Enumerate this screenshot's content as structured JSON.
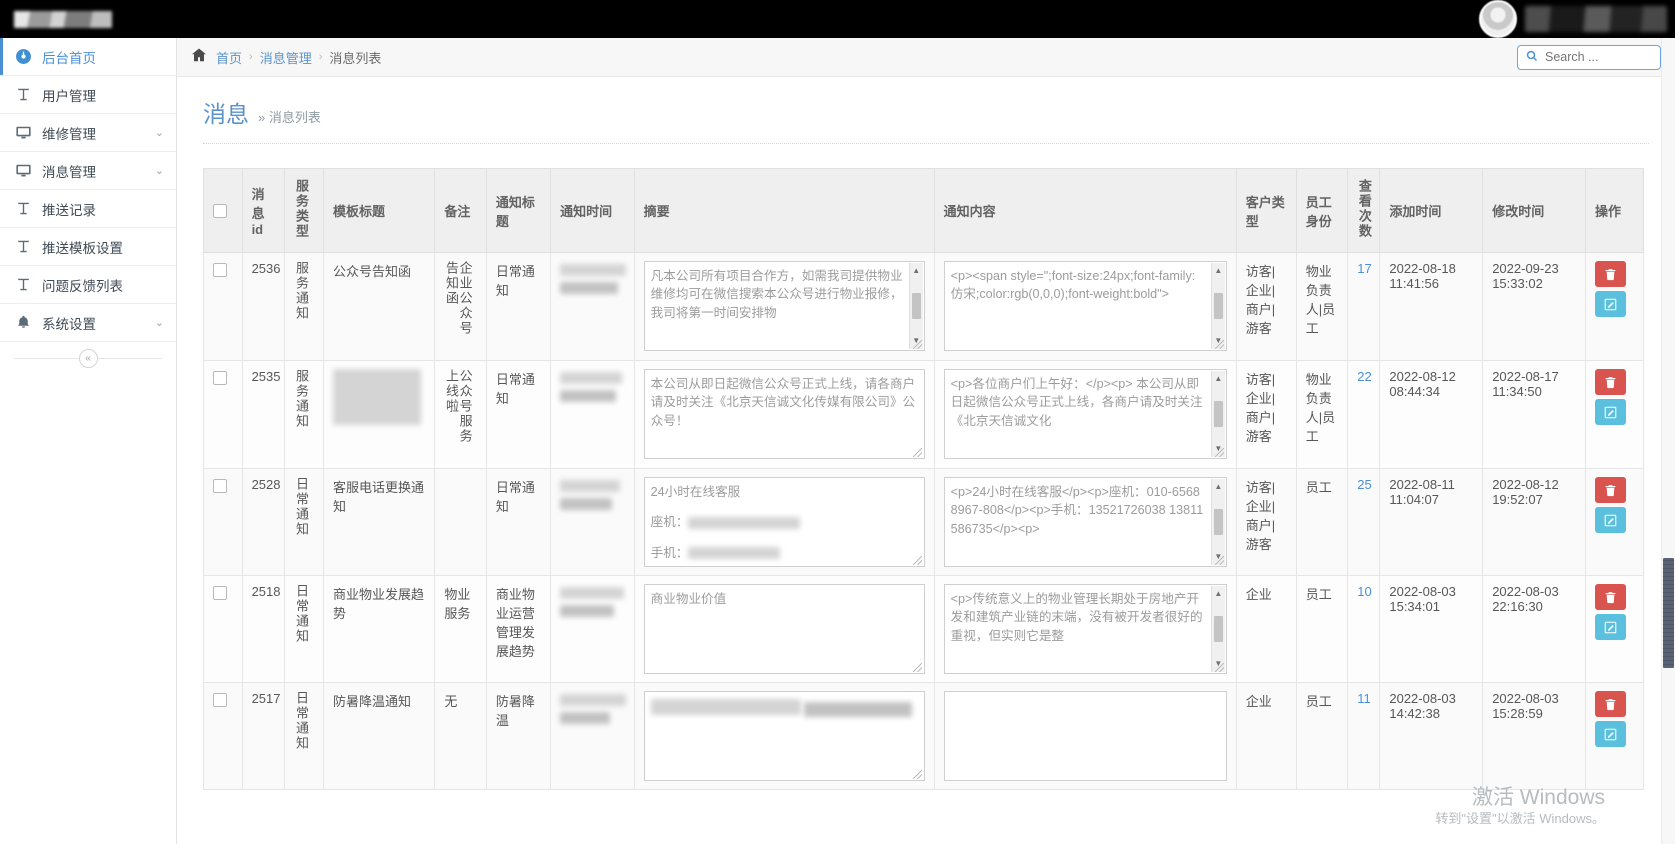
{
  "topbar": {
    "brand_label": "",
    "user_label": "",
    "avatar_name": "user-avatar"
  },
  "sidebar": {
    "items": [
      {
        "label": "后台首页",
        "icon": "dashboard-icon",
        "active": true,
        "expandable": false
      },
      {
        "label": "用户管理",
        "icon": "text-icon",
        "active": false,
        "expandable": false
      },
      {
        "label": "维修管理",
        "icon": "monitor-icon",
        "active": false,
        "expandable": true
      },
      {
        "label": "消息管理",
        "icon": "monitor-icon",
        "active": false,
        "expandable": true
      },
      {
        "label": "推送记录",
        "icon": "text-icon",
        "active": false,
        "expandable": false
      },
      {
        "label": "推送模板设置",
        "icon": "text-icon",
        "active": false,
        "expandable": false
      },
      {
        "label": "问题反馈列表",
        "icon": "text-icon",
        "active": false,
        "expandable": false
      },
      {
        "label": "系统设置",
        "icon": "bell-icon",
        "active": false,
        "expandable": true
      }
    ],
    "collapse_label": "«"
  },
  "breadcrumb": {
    "home_icon": "home-icon",
    "items": [
      "首页",
      "消息管理",
      "消息列表"
    ],
    "separator": "›"
  },
  "search": {
    "placeholder": "Search ...",
    "value": "",
    "icon": "search-icon"
  },
  "page": {
    "title": "消息",
    "subtitle": "» 消息列表"
  },
  "table": {
    "columns": [
      {
        "key": "check",
        "label": "",
        "vertical": false
      },
      {
        "key": "id",
        "label": "消息id",
        "vertical": false
      },
      {
        "key": "svc",
        "label": "服务类型",
        "vertical": true
      },
      {
        "key": "tpl",
        "label": "模板标题",
        "vertical": false
      },
      {
        "key": "note",
        "label": "备注",
        "vertical": false
      },
      {
        "key": "ntitle",
        "label": "通知标题",
        "vertical": false
      },
      {
        "key": "ntime",
        "label": "通知时间",
        "vertical": false
      },
      {
        "key": "abs",
        "label": "摘要",
        "vertical": false
      },
      {
        "key": "content",
        "label": "通知内容",
        "vertical": false
      },
      {
        "key": "ctype",
        "label": "客户类型",
        "vertical": false
      },
      {
        "key": "emp",
        "label": "员工身份",
        "vertical": false
      },
      {
        "key": "views",
        "label": "查看次数",
        "vertical": true
      },
      {
        "key": "added",
        "label": "添加时间",
        "vertical": false
      },
      {
        "key": "modified",
        "label": "修改时间",
        "vertical": false
      },
      {
        "key": "op",
        "label": "操作",
        "vertical": false
      }
    ],
    "rows": [
      {
        "id": "2536",
        "svc": "服务通知",
        "tpl": "公众号告知函",
        "tpl_redacted": false,
        "note": "企业公众号告知函",
        "ntitle": "日常通知",
        "ntime_redacted": true,
        "abs": "凡本公司所有项目合作方，如需我司提供物业维修均可在微信搜索本公众号进行物业报修，我司将第一时间安排物",
        "abs_scroll": true,
        "content": "<p><span style=\";font-size:24px;font-family:仿宋;color:rgb(0,0,0);font-weight:bold\">",
        "content_scroll": true,
        "ctype": "访客|企业|商户|游客",
        "emp": "物业负责人|员工",
        "views": "17",
        "added": "2022-08-18 11:41:56",
        "modified": "2022-09-23 15:33:02"
      },
      {
        "id": "2535",
        "svc": "服务通知",
        "tpl": "",
        "tpl_redacted": true,
        "note": "公众号服务上线啦",
        "ntitle": "日常通知",
        "ntime_redacted": true,
        "abs": "本公司从即日起微信公众号正式上线，请各商户请及时关注《北京天信诚文化传媒有限公司》公众号！",
        "abs_scroll": false,
        "content": "<p>各位商户们上午好：</p><p>  本公司从即日起微信公众号正式上线，各商户请及时关注《北京天信诚文化",
        "content_scroll": true,
        "ctype": "访客|企业|商户|游客",
        "emp": "物业负责人|员工",
        "views": "22",
        "added": "2022-08-12 08:44:34",
        "modified": "2022-08-17 11:34:50"
      },
      {
        "id": "2528",
        "svc": "日常通知",
        "tpl": "客服电话更换通知",
        "tpl_redacted": false,
        "note": "",
        "ntitle": "日常通知",
        "ntime_redacted": true,
        "abs": "24小时在线客服",
        "abs_line2_label": "座机：",
        "abs_line3_label": "手机：",
        "abs_redacted_lines": true,
        "abs_scroll": false,
        "content": "<p>24小时在线客服</p><p>座机：010-65688967-808</p><p>手机：13521726038 13811586735</p><p>",
        "content_scroll": true,
        "ctype": "访客|企业|商户|游客",
        "emp": "员工",
        "views": "25",
        "added": "2022-08-11 11:04:07",
        "modified": "2022-08-12 19:52:07"
      },
      {
        "id": "2518",
        "svc": "日常通知",
        "tpl": "商业物业发展趋势",
        "tpl_redacted": false,
        "note": "物业服务",
        "ntitle": "商业物业运营管理发展趋势",
        "ntime_redacted": true,
        "abs": "商业物业价值",
        "abs_scroll": false,
        "content": "<p>传统意义上的物业管理长期处于房地产开发和建筑产业链的末端，没有被开发者很好的重视，但实则它是整",
        "content_scroll": true,
        "ctype": "企业",
        "emp": "员工",
        "views": "10",
        "added": "2022-08-03 15:34:01",
        "modified": "2022-08-03 22:16:30"
      },
      {
        "id": "2517",
        "svc": "日常通知",
        "tpl": "防暑降温通知",
        "tpl_redacted": false,
        "note": "无",
        "ntitle": "防暑降温",
        "ntime_redacted": true,
        "abs": "",
        "abs_redacted": true,
        "abs_scroll": false,
        "content": "",
        "content_scroll": false,
        "ctype": "企业",
        "emp": "员工",
        "views": "11",
        "added": "2022-08-03 14:42:38",
        "modified": "2022-08-03 15:28:59"
      }
    ],
    "op": {
      "delete_icon": "trash-icon",
      "edit_icon": "pencil-square-icon"
    }
  },
  "watermark": {
    "line1": "激活 Windows",
    "line2": "转到\"设置\"以激活 Windows。"
  },
  "colors": {
    "accent": "#5b93c9",
    "delete": "#d9534f",
    "edit": "#5bc0de",
    "topbar": "#000000",
    "header_bg": "#efefef"
  }
}
